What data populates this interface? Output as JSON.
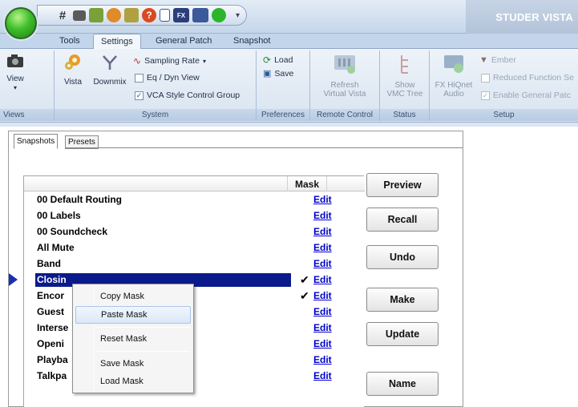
{
  "window": {
    "title": "STUDER VISTA"
  },
  "quick_access_icons": [
    "grid-icon",
    "camera-icon",
    "mixer-icon",
    "palette-icon",
    "settings-icon",
    "help-icon",
    "document-icon",
    "fx-icon",
    "display-icon",
    "green-dot-icon"
  ],
  "tabs": [
    "Tools",
    "Settings",
    "General Patch",
    "Snapshot"
  ],
  "active_tab": "Settings",
  "ribbon": {
    "views": {
      "view_label": "View",
      "group": "Views"
    },
    "system": {
      "vista_label": "Vista",
      "downmix_label": "Downmix",
      "sampling_rate_label": "Sampling Rate",
      "eq_dyn_label": "Eq / Dyn View",
      "vca_label": "VCA Style Control Group",
      "eq_dyn_checked": false,
      "vca_checked": true,
      "group": "System"
    },
    "preferences": {
      "load_label": "Load",
      "save_label": "Save",
      "group": "Preferences"
    },
    "remote_control": {
      "refresh_label_1": "Refresh",
      "refresh_label_2": "Virtual Vista",
      "group": "Remote Control"
    },
    "status": {
      "show_label_1": "Show",
      "show_label_2": "VMC Tree",
      "group": "Status"
    },
    "setup": {
      "fx_label_1": "FX HiQnet",
      "fx_label_2": "Audio",
      "ember_label": "Ember",
      "reduced_label": "Reduced Function Se",
      "enable_label": "Enable General Patc",
      "group": "Setup"
    }
  },
  "panel_tabs": [
    "Snapshots",
    "Presets"
  ],
  "active_panel_tab": "Snapshots",
  "grid": {
    "mask_header": "Mask",
    "edit_label": "Edit",
    "rows": [
      {
        "name": "00 Default Routing",
        "checked": false
      },
      {
        "name": "00 Labels",
        "checked": false
      },
      {
        "name": "00 Soundcheck",
        "checked": false
      },
      {
        "name": "All Mute",
        "checked": false
      },
      {
        "name": "Band",
        "checked": false
      },
      {
        "name": "Closin",
        "checked": true,
        "selected": true
      },
      {
        "name": "Encor",
        "checked": true
      },
      {
        "name": "Guest",
        "checked": false
      },
      {
        "name": "Interse",
        "checked": false
      },
      {
        "name": "Openi",
        "checked": false
      },
      {
        "name": "Playba",
        "checked": false
      },
      {
        "name": "Talkpa",
        "checked": false
      }
    ],
    "check_mark": "✔"
  },
  "buttons": [
    "Preview",
    "Recall",
    "Undo",
    "Make",
    "Update",
    "Name"
  ],
  "context_menu": {
    "items": [
      "Copy Mask",
      "Paste Mask",
      "Reset Mask",
      "Save Mask",
      "Load Mask"
    ],
    "hovered": "Paste Mask"
  }
}
